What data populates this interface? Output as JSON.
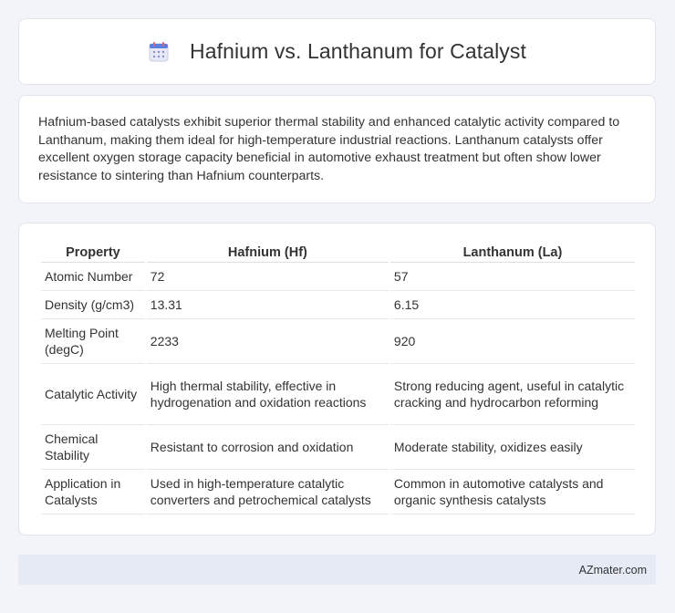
{
  "header": {
    "title": "Hafnium vs. Lanthanum for Catalyst",
    "icon": "calendar-icon"
  },
  "summary": {
    "text": "Hafnium-based catalysts exhibit superior thermal stability and enhanced catalytic activity compared to Lanthanum, making them ideal for high-temperature industrial reactions. Lanthanum catalysts offer excellent oxygen storage capacity beneficial in automotive exhaust treatment but often show lower resistance to sintering than Hafnium counterparts."
  },
  "table": {
    "headers": [
      "Property",
      "Hafnium (Hf)",
      "Lanthanum (La)"
    ],
    "rows": [
      [
        "Atomic Number",
        "72",
        "57"
      ],
      [
        "Density (g/cm3)",
        "13.31",
        "6.15"
      ],
      [
        "Melting Point (degC)",
        "2233",
        "920"
      ],
      [
        "Catalytic Activity",
        "High thermal stability, effective in hydrogenation and oxidation reactions",
        "Strong reducing agent, useful in catalytic cracking and hydrocarbon reforming"
      ],
      [
        "Chemical Stability",
        "Resistant to corrosion and oxidation",
        "Moderate stability, oxidizes easily"
      ],
      [
        "Application in Catalysts",
        "Used in high-temperature catalytic converters and petrochemical catalysts",
        "Common in automotive catalysts and organic synthesis catalysts"
      ]
    ]
  },
  "footer": {
    "brand": "AZmater.com"
  }
}
